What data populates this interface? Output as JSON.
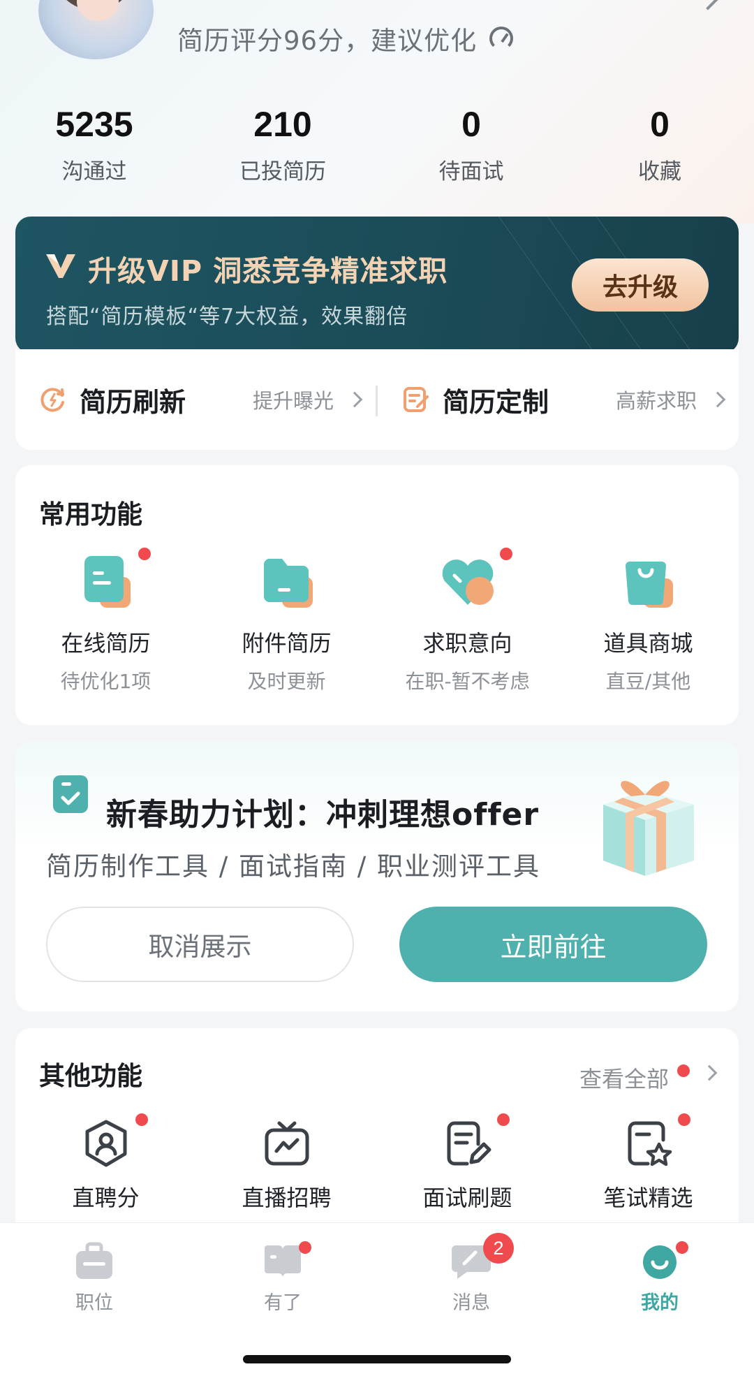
{
  "profile": {
    "score_text": "简历评分96分，建议优化"
  },
  "stats": [
    {
      "value": "5235",
      "label": "沟通过"
    },
    {
      "value": "210",
      "label": "已投简历"
    },
    {
      "value": "0",
      "label": "待面试"
    },
    {
      "value": "0",
      "label": "收藏"
    }
  ],
  "vip": {
    "title": "升级VIP 洞悉竞争精准求职",
    "subtitle": "搭配“简历模板“等7大权益，效果翻倍",
    "button": "去升级"
  },
  "quick": [
    {
      "title": "简历刷新",
      "sub": "提升曝光"
    },
    {
      "title": "简历定制",
      "sub": "高薪求职"
    }
  ],
  "common": {
    "title": "常用功能",
    "items": [
      {
        "name": "在线简历",
        "sub": "待优化1项"
      },
      {
        "name": "附件简历",
        "sub": "及时更新"
      },
      {
        "name": "求职意向",
        "sub": "在职-暂不考虑"
      },
      {
        "name": "道具商城",
        "sub": "直豆/其他"
      }
    ]
  },
  "promo": {
    "title": "新春助力计划：冲刺理想offer",
    "subtitle": "简历制作工具 / 面试指南 / 职业测评工具",
    "cancel": "取消展示",
    "go": "立即前往"
  },
  "other": {
    "title": "其他功能",
    "view_all": "查看全部",
    "items": [
      {
        "name": "直聘分"
      },
      {
        "name": "直播招聘"
      },
      {
        "name": "面试刷题"
      },
      {
        "name": "笔试精选"
      }
    ]
  },
  "tabs": [
    {
      "label": "职位"
    },
    {
      "label": "有了"
    },
    {
      "label": "消息",
      "badge": "2"
    },
    {
      "label": "我的"
    }
  ],
  "colors": {
    "accent": "#4fb1ad",
    "vip_bg": "#1b4c58",
    "vip_gold": "#f3d3b3",
    "badge_red": "#ef4b4f"
  }
}
